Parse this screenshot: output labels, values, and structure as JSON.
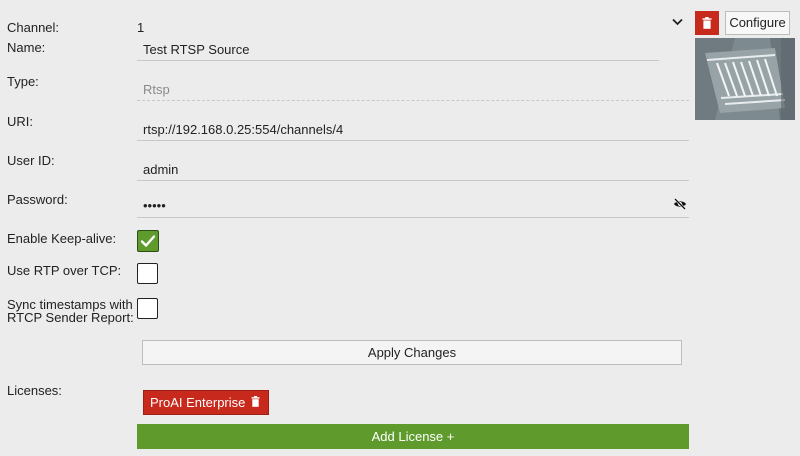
{
  "form": {
    "channel": {
      "label": "Channel:",
      "value": "1"
    },
    "name": {
      "label": "Name:",
      "value": "Test RTSP Source"
    },
    "type": {
      "label": "Type:",
      "value": "Rtsp"
    },
    "uri": {
      "label": "URI:",
      "value": "rtsp://192.168.0.25:554/channels/4"
    },
    "user_id": {
      "label": "User ID:",
      "value": "admin"
    },
    "password": {
      "label": "Password:",
      "value": "•••••"
    },
    "keep_alive": {
      "label": "Enable Keep-alive:",
      "checked": true
    },
    "rtp_over_tcp": {
      "label": "Use RTP over TCP:",
      "checked": false
    },
    "sync_timestamps": {
      "label_line1": "Sync timestamps with",
      "label_line2": "RTCP Sender Report:",
      "checked": false
    },
    "apply_label": "Apply Changes"
  },
  "licenses": {
    "label": "Licenses:",
    "items": [
      {
        "name": "ProAI Enterprise"
      }
    ],
    "add_label": "Add License +"
  },
  "header": {
    "configure_label": "Configure",
    "collapse_icon": "chevron-down-icon",
    "delete_icon": "trash-icon"
  },
  "colors": {
    "accent_green": "#5e9a2c",
    "danger_red": "#c8291d",
    "background": "#ececec"
  }
}
